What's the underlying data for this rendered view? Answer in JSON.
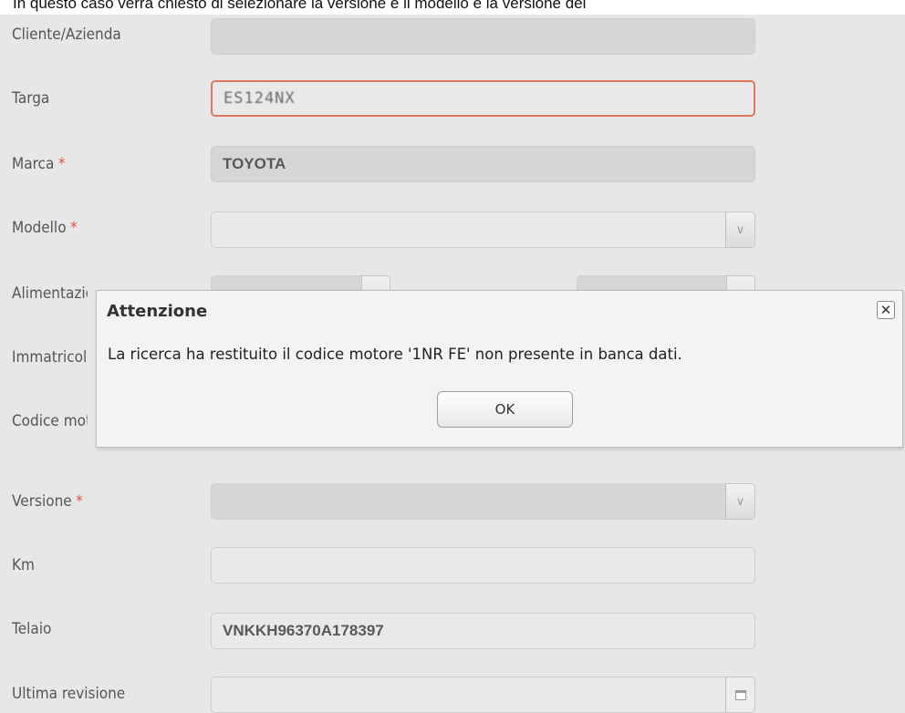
{
  "top_note": "In questo caso verrà chiesto di selezionare la versione e il modello e la versione del",
  "form": {
    "cliente": {
      "label": "Cliente/Azienda",
      "value": ""
    },
    "targa": {
      "label": "Targa",
      "value": "ES124NX"
    },
    "marca": {
      "label": "Marca",
      "required": "*",
      "value": "TOYOTA"
    },
    "modello": {
      "label": "Modello",
      "required": "*",
      "value": ""
    },
    "alimentazione": {
      "label": "Alimentazione"
    },
    "immatricolazione": {
      "label": "Immatricolazione"
    },
    "codice_motore": {
      "label": "Codice motore"
    },
    "versione": {
      "label": "Versione",
      "required": "*",
      "value": ""
    },
    "km": {
      "label": "Km",
      "value": ""
    },
    "telaio": {
      "label": "Telaio",
      "value": "VNKKH96370A178397"
    },
    "ultima_revisione": {
      "label": "Ultima revisione",
      "value": ""
    }
  },
  "icons": {
    "dropdown": "chevron-down-icon",
    "calendar": "calendar-icon",
    "close": "close-icon"
  },
  "dialog": {
    "title": "Attenzione",
    "close_glyph": "✕",
    "message": "La ricerca ha restituito il codice motore '1NR FE' non presente in banca dati.",
    "ok_label": "OK"
  },
  "colors": {
    "background": "#e7e7e7",
    "field_bg": "#d6d6d6",
    "active_border": "#e07560",
    "required": "#e0533b"
  }
}
